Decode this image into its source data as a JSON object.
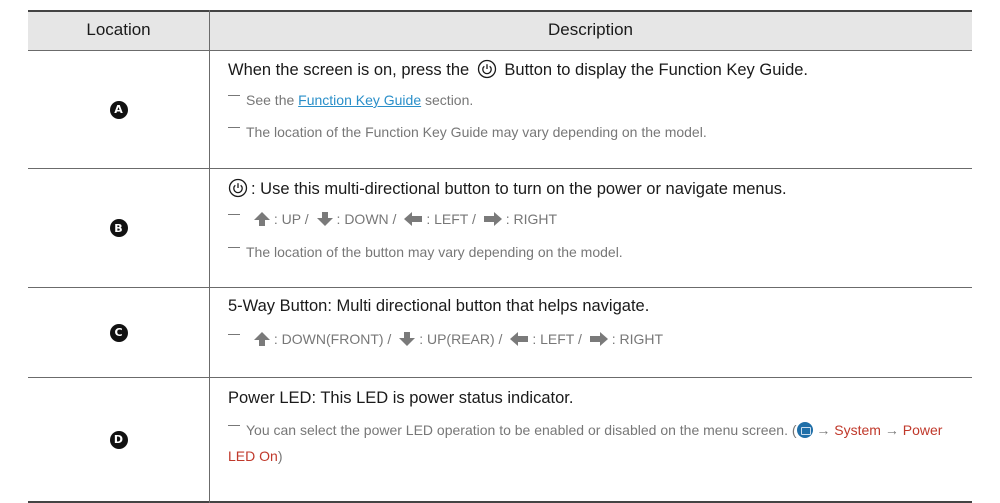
{
  "header": {
    "location": "Location",
    "description": "Description"
  },
  "rows": [
    {
      "badge": "A",
      "main_pre": "When the screen is on, press the",
      "main_post": "Button to display the Function Key Guide.",
      "note1_pre": "See the",
      "note1_link": "Function Key Guide",
      "note1_post": "section.",
      "note2": "The location of the Function Key Guide may vary depending on the model."
    },
    {
      "badge": "B",
      "main_post": ": Use this multi-directional button to turn on the power or navigate menus.",
      "up": ": UP /",
      "down": ": DOWN /",
      "left": ": LEFT /",
      "right": ": RIGHT",
      "note2": "The location of the button may vary depending on the model."
    },
    {
      "badge": "C",
      "main": "5-Way Button: Multi directional button that helps navigate.",
      "up": ": DOWN(FRONT) /",
      "down": ": UP(REAR) /",
      "left": ": LEFT /",
      "right": ": RIGHT"
    },
    {
      "badge": "D",
      "main_label": "Power LED",
      "main_post": ": This LED is power status indicator.",
      "note_pre": "You can select the power LED operation to be enabled or disabled on the menu screen. (",
      "arrow": "→",
      "menu1": "System",
      "menu2": "Power LED On",
      "note_close": ")"
    }
  ],
  "colors": {
    "header_bg": "#e6e6e6",
    "link": "#2a8fc9",
    "menu_red": "#c0392b",
    "note_gray": "#777777"
  },
  "icons": [
    "power-button-icon",
    "arrow-up-icon",
    "arrow-down-icon",
    "arrow-left-icon",
    "arrow-right-icon",
    "menu-icon"
  ]
}
